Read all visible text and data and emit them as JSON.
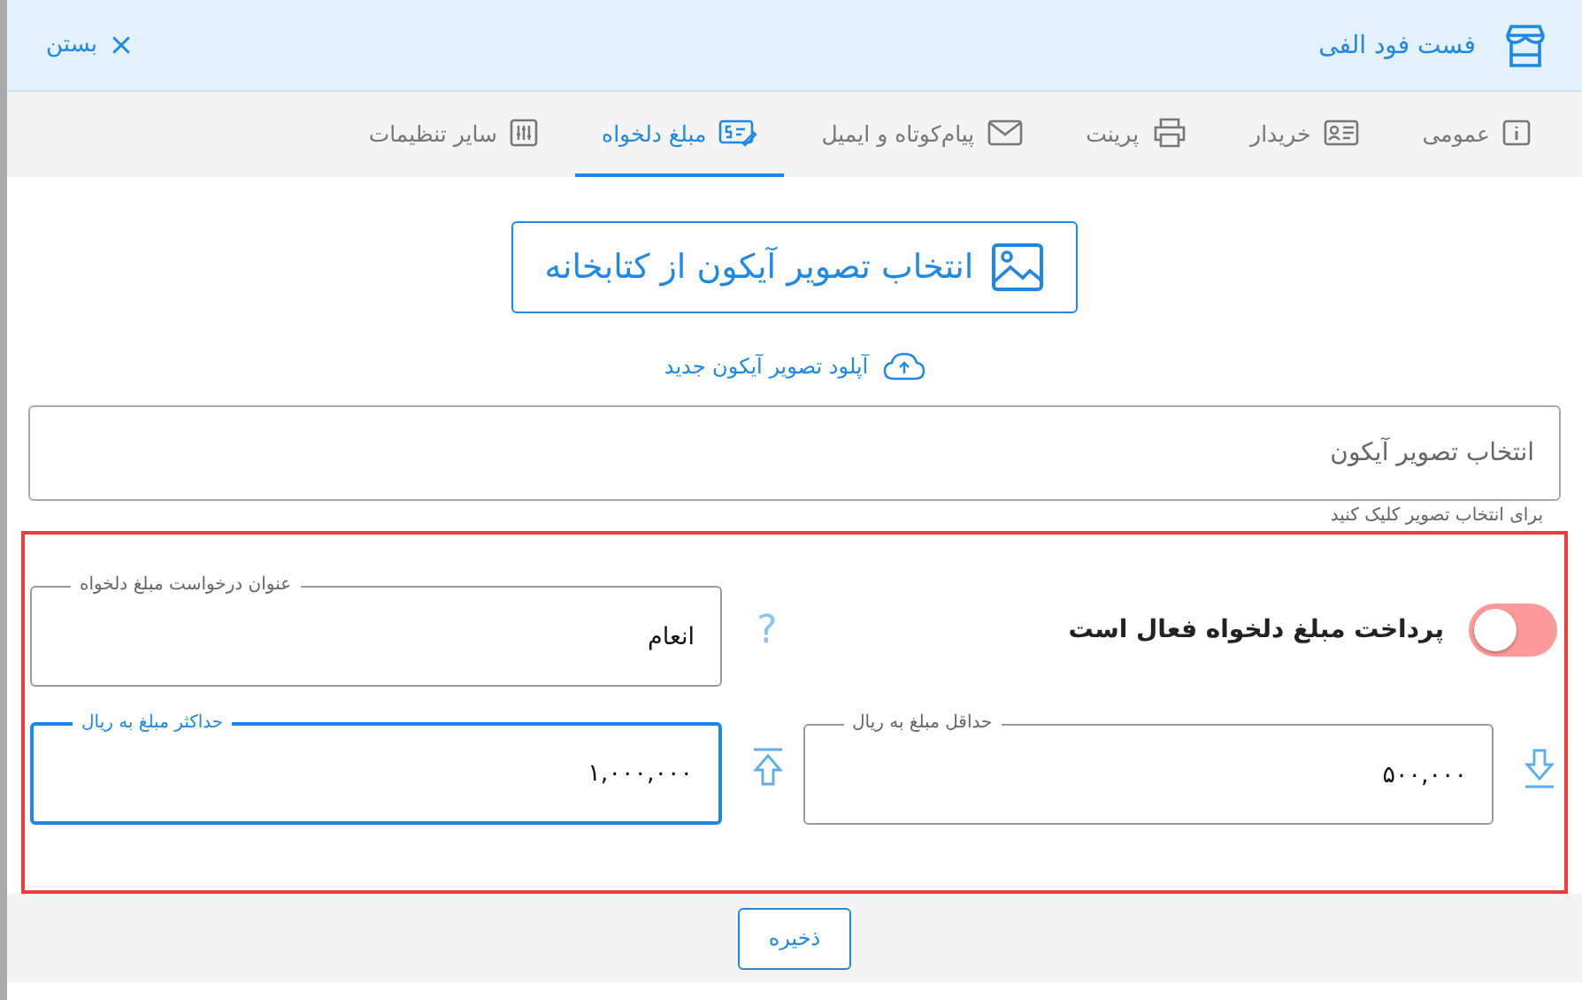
{
  "header": {
    "title": "فست فود الفی",
    "close_label": "بستن"
  },
  "tabs": [
    {
      "label": "عمومی",
      "selected": false
    },
    {
      "label": "خریدار",
      "selected": false
    },
    {
      "label": "پرینت",
      "selected": false
    },
    {
      "label": "پیام‌کوتاه و ایمیل",
      "selected": false
    },
    {
      "label": "مبلغ دلخواه",
      "selected": true
    },
    {
      "label": "سایر تنظیمات",
      "selected": false
    }
  ],
  "library_button": "انتخاب تصویر آیکون از کتابخانه",
  "upload_link": "آپلود تصویر آیکون جدید",
  "icon_field": {
    "placeholder": "انتخاب تصویر آیکون",
    "hint": "برای انتخاب تصویر کلیک کنید"
  },
  "custom_amount": {
    "toggle": {
      "label": "پرداخت مبلغ دلخواه فعال است",
      "on": false
    },
    "help_mark": "?",
    "title_field": {
      "label": "عنوان درخواست مبلغ دلخواه",
      "value": "انعام",
      "focused": false
    },
    "min_field": {
      "label": "حداقل مبلغ به ریال",
      "value": "۵۰۰,۰۰۰",
      "focused": false
    },
    "max_field": {
      "label": "حداکثر مبلغ به ریال",
      "value": "۱,۰۰۰,۰۰۰",
      "focused": true
    }
  },
  "save_button": "ذخیره"
}
